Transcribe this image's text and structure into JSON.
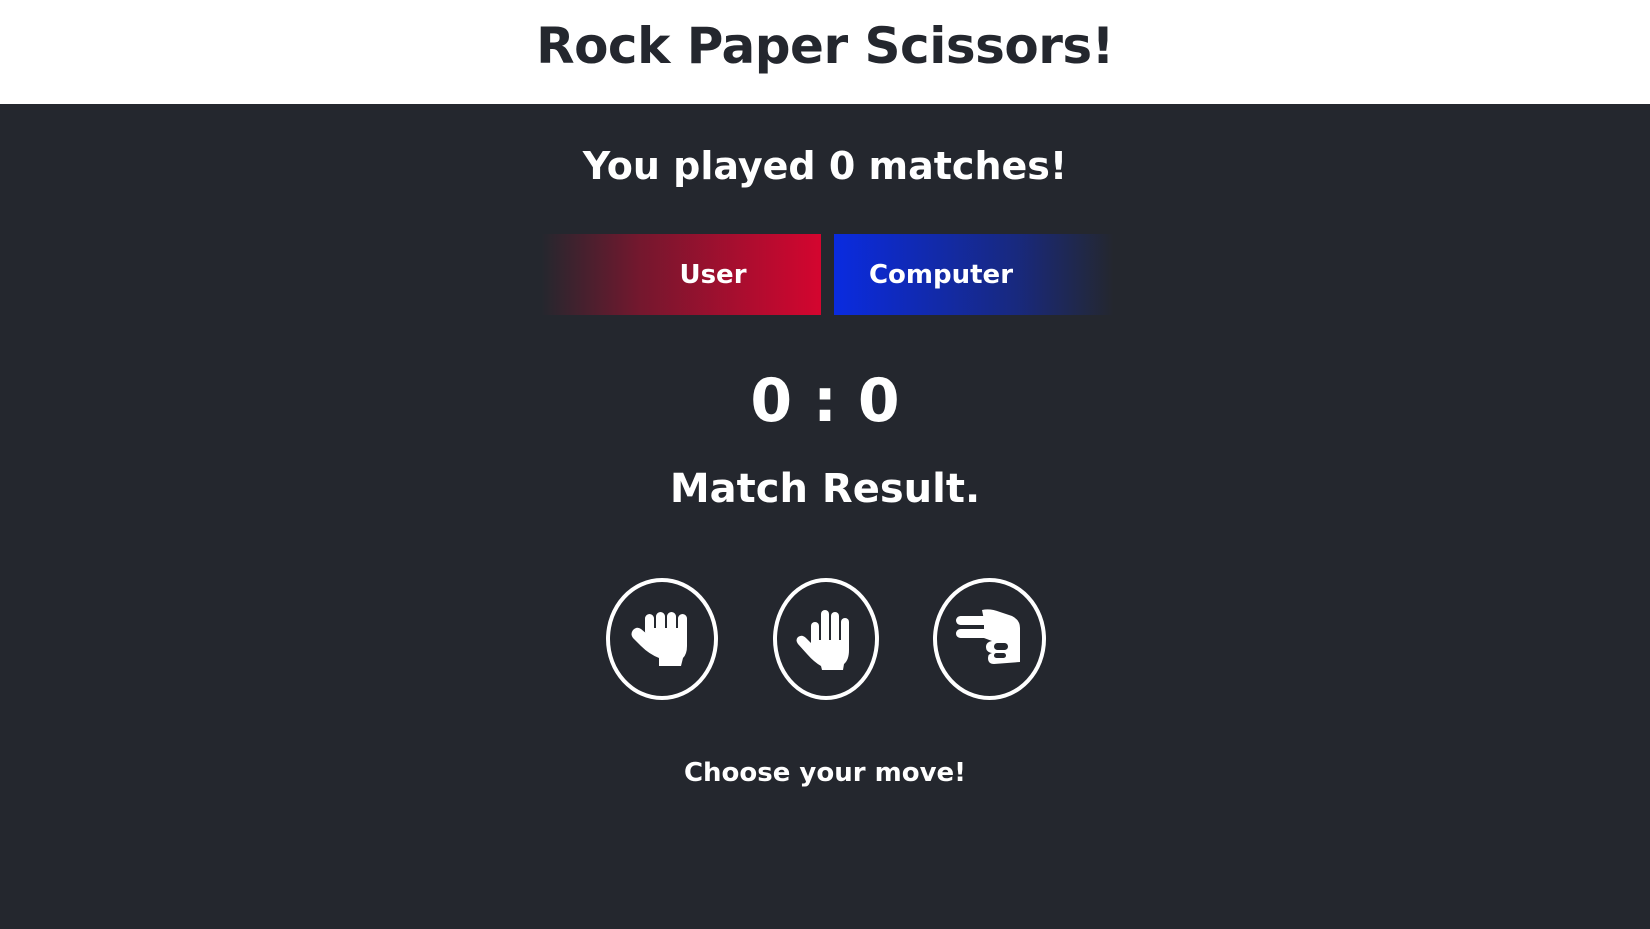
{
  "header": {
    "title": "Rock Paper Scissors!"
  },
  "stats": {
    "played_text": "You played 0 matches!"
  },
  "players": {
    "user_label": "User",
    "computer_label": "Computer"
  },
  "score": {
    "text": "0 : 0"
  },
  "match": {
    "result_text": "Match Result."
  },
  "moves": [
    {
      "name": "rock",
      "icon": "fist-icon"
    },
    {
      "name": "paper",
      "icon": "open-hand-icon"
    },
    {
      "name": "scissors",
      "icon": "scissors-hand-icon"
    }
  ],
  "prompt": {
    "text": "Choose your move!"
  },
  "colors": {
    "background": "#24272e",
    "header_bg": "#ffffff",
    "user_accent": "#d4052f",
    "computer_accent": "#0a2be0"
  }
}
